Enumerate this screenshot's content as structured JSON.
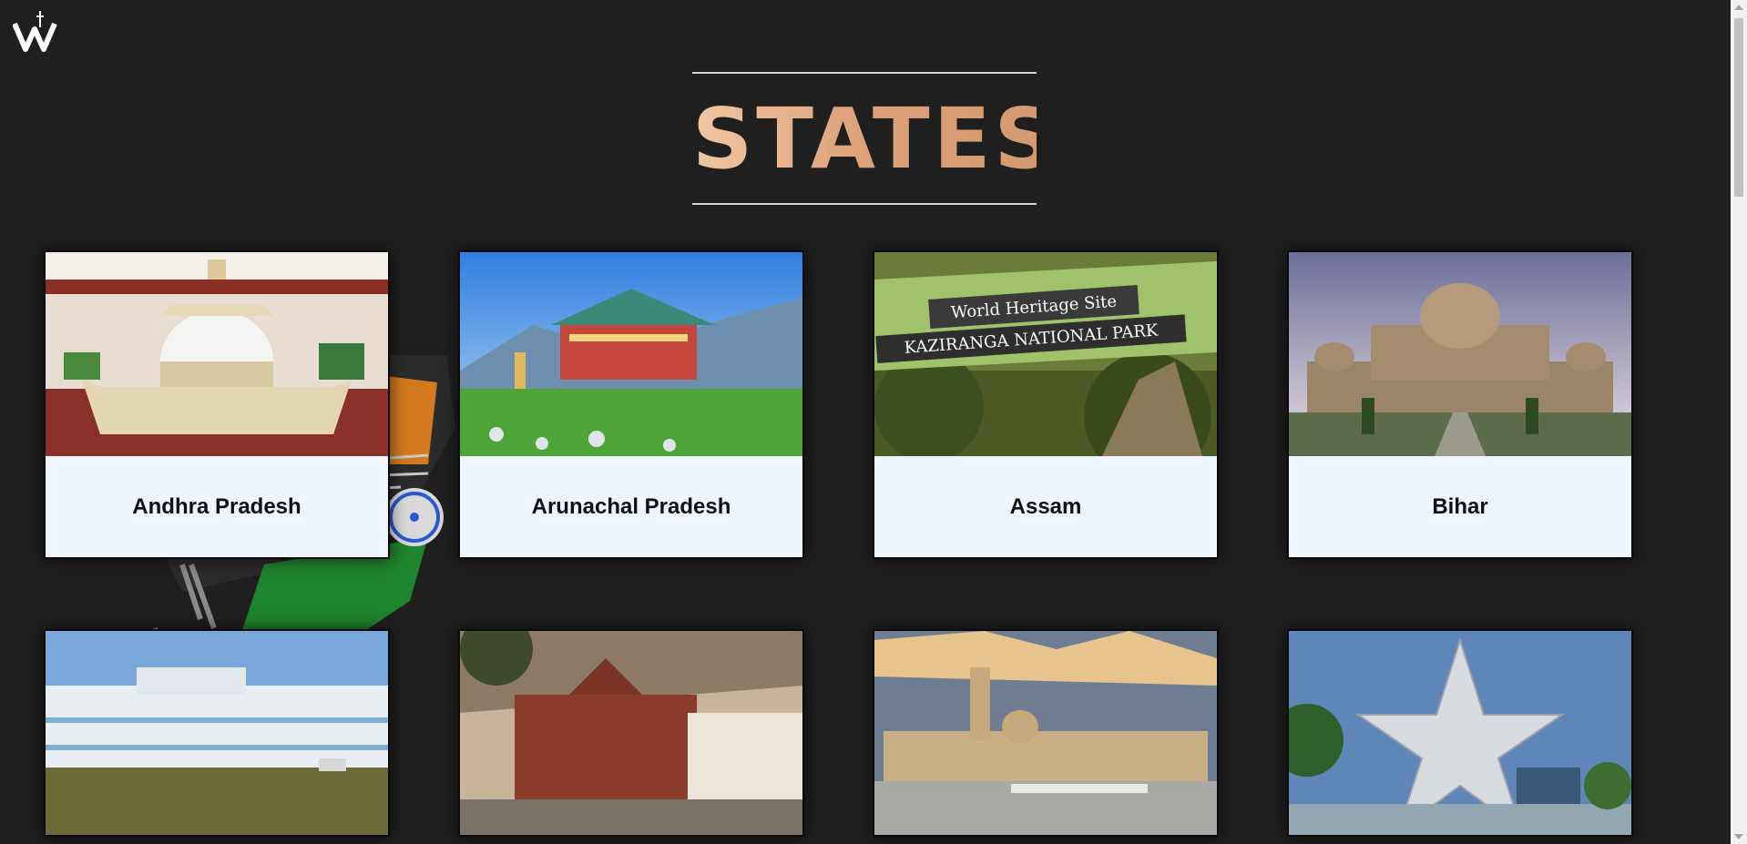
{
  "page": {
    "title": "STATES",
    "logo_icon": "w-monogram-logo-icon"
  },
  "states": [
    {
      "name": "Andhra Pradesh",
      "image": "stupa-model-photo"
    },
    {
      "name": "Arunachal Pradesh",
      "image": "monastery-photo"
    },
    {
      "name": "Assam",
      "image": "kaziranga-sign-photo",
      "image_text": [
        "World Heritage Site",
        "KAZIRANGA NATIONAL PARK"
      ]
    },
    {
      "name": "Bihar",
      "image": "tomb-palace-photo"
    },
    {
      "name": "",
      "image": "colonial-palace-photo"
    },
    {
      "name": "",
      "image": "basilica-photo"
    },
    {
      "name": "",
      "image": "laxmi-vilas-palace-photo"
    },
    {
      "name": "",
      "image": "star-monument-photo"
    }
  ],
  "colors": {
    "background": "#1f1f1f",
    "title_gradient": [
      "#f0c6a2",
      "#d49a71"
    ],
    "card_label_bg": "#eef5ff"
  }
}
